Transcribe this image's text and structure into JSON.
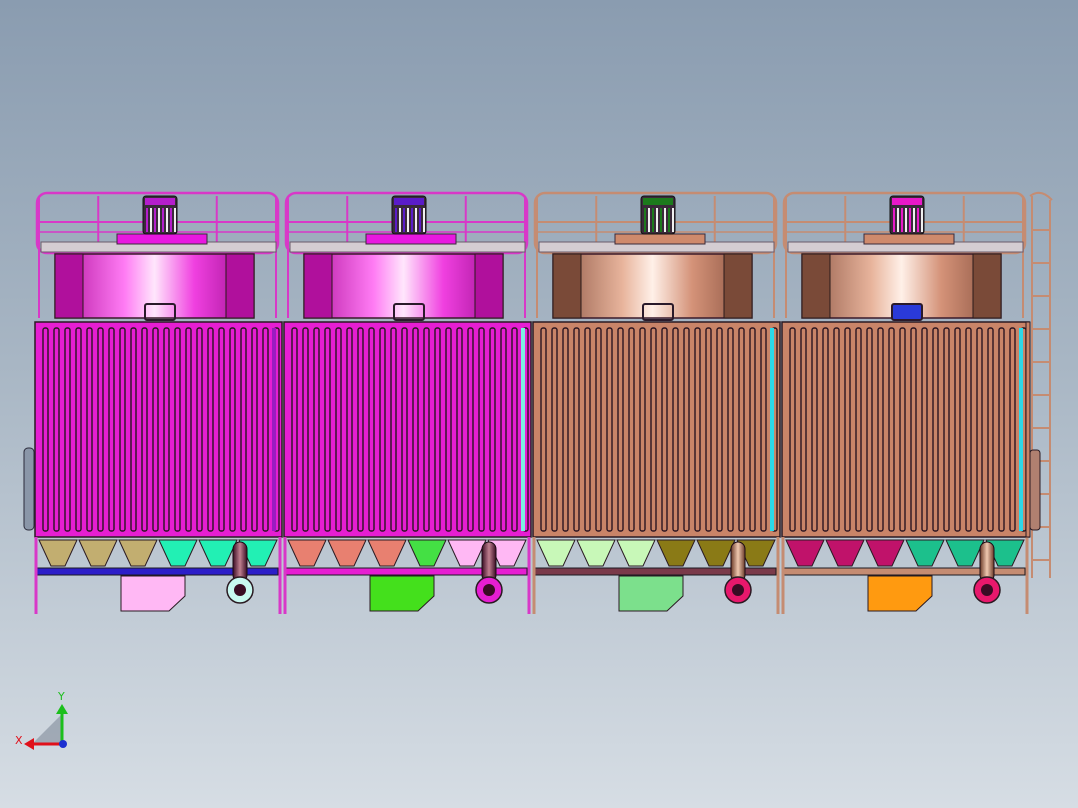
{
  "triad": {
    "x_label": "X",
    "y_label": "Y",
    "x_color": "#e0101a",
    "y_color": "#1cbf1c",
    "z_color": "#1c2fd0"
  },
  "cells": [
    {
      "name": "cell-1",
      "shroud_color": "#e818e0",
      "casing_color": "#e61ed2",
      "rail_color": "#d838c8",
      "motor_band": "#b41ecc",
      "basin_colors": [
        "#c2ae70",
        "#c2ae70",
        "#c2ae70",
        "#22f0b4",
        "#22f0b4",
        "#22f0b4"
      ],
      "panel_color": "#ffb8f4",
      "frame_bar": "#2c1ec8",
      "accent_strip": "#9a1cc0"
    },
    {
      "name": "cell-2",
      "shroud_color": "#e818e0",
      "casing_color": "#e61ed2",
      "rail_color": "#d838c8",
      "motor_band": "#5a1cc8",
      "basin_colors": [
        "#e88070",
        "#e88070",
        "#e88070",
        "#44e044",
        "#ffb8f4",
        "#ffb8f4"
      ],
      "panel_color": "#44e01c",
      "frame_bar": "#e61ed2",
      "accent_strip": "#7cf0e0"
    },
    {
      "name": "cell-3",
      "shroud_color": "#cf8a6c",
      "casing_color": "#c98468",
      "rail_color": "#c58c72",
      "motor_band": "#1c7a1c",
      "basin_colors": [
        "#c8f8b8",
        "#c8f8b8",
        "#c8f8b8",
        "#8a7a16",
        "#8a7a16",
        "#8a7a16"
      ],
      "panel_color": "#7ce08c",
      "frame_bar": "#7a3a4a",
      "accent_strip": "#2cd8e8"
    },
    {
      "name": "cell-4",
      "shroud_color": "#cf8a6c",
      "casing_color": "#c98468",
      "rail_color": "#c58c72",
      "motor_band": "#e818c8",
      "basin_colors": [
        "#c0126a",
        "#c0126a",
        "#c0126a",
        "#1cc08c",
        "#1cc08c",
        "#1cc08c"
      ],
      "panel_color": "#ff9a10",
      "frame_bar": "#c58c72",
      "accent_strip": "#2cd8e8"
    }
  ]
}
